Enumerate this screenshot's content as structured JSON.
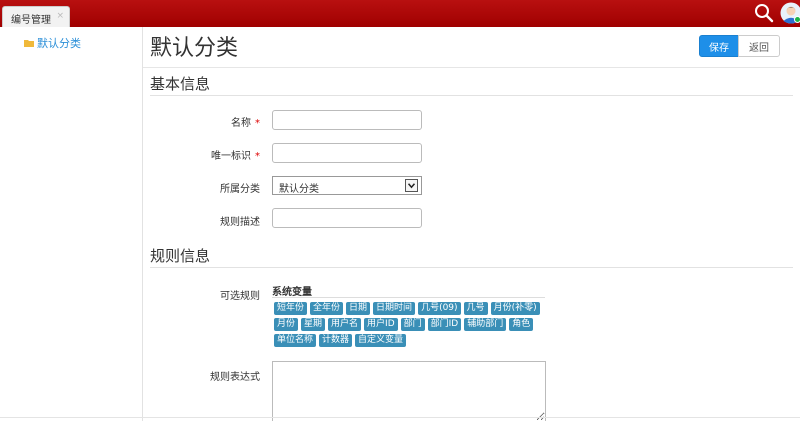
{
  "topbar": {
    "tab_label": "编号管理",
    "tab_close": "×",
    "search_icon": "search-icon",
    "avatar_icon": "user-avatar-icon"
  },
  "sidebar": {
    "items": [
      {
        "label": "默认分类",
        "icon": "folder-icon"
      }
    ]
  },
  "header": {
    "title": "默认分类",
    "save_label": "保存",
    "back_label": "返回"
  },
  "basic": {
    "title": "基本信息",
    "name_label": "名称",
    "key_label": "唯一标识",
    "required_mark": "*",
    "category_label": "所属分类",
    "category_value": "默认分类",
    "desc_label": "规则描述",
    "name_value": "",
    "key_value": "",
    "desc_value": ""
  },
  "rules": {
    "title": "规则信息",
    "available_label": "可选规则",
    "vars_title": "系统变量",
    "chip_rows": [
      [
        "短年份",
        "全年份",
        "日期",
        "日期时间",
        "几号(09)",
        "几号",
        "月份(补零)"
      ],
      [
        "月份",
        "星期",
        "用户名",
        "用户ID",
        "部门",
        "部门ID",
        "辅助部门",
        "角色"
      ],
      [
        "单位名称",
        "计数器",
        "自定义变量"
      ]
    ],
    "expression_label": "规则表达式",
    "expression_value": ""
  },
  "colors": {
    "topbar": "#a80000",
    "primary": "#1e8fe8",
    "chip": "#3a8fb7",
    "link": "#2b8fd8",
    "required": "#dd0000"
  }
}
